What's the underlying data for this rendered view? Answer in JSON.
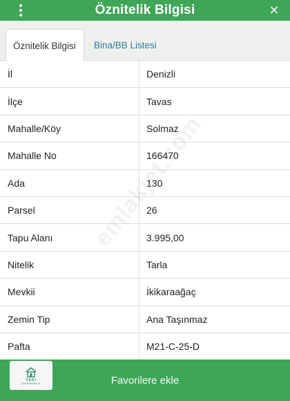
{
  "header": {
    "title": "Öznitelik Bilgisi",
    "menu_icon": "more-vertical-icon",
    "close_icon": "close-icon",
    "close_glyph": "✕",
    "color": "#3fa658"
  },
  "tabs": [
    {
      "label": "Öznitelik Bilgisi",
      "active": true
    },
    {
      "label": "Bina/BB Listesi",
      "active": false
    }
  ],
  "rows": [
    {
      "key": "İl",
      "value": "Denizli"
    },
    {
      "key": "İlçe",
      "value": "Tavas"
    },
    {
      "key": "Mahalle/Köy",
      "value": "Solmaz"
    },
    {
      "key": "Mahalle No",
      "value": "166470"
    },
    {
      "key": "Ada",
      "value": "130"
    },
    {
      "key": "Parsel",
      "value": "26"
    },
    {
      "key": "Tapu Alanı",
      "value": "3.995,00"
    },
    {
      "key": "Nitelik",
      "value": "Tarla"
    },
    {
      "key": "Mevkii",
      "value": "İkikaraağaç"
    },
    {
      "key": "Zemin Tip",
      "value": "Ana Taşınmaz"
    },
    {
      "key": "Pafta",
      "value": "M21-C-25-D"
    }
  ],
  "watermark": "emlakjet.com",
  "footer": {
    "button_label": "Favorilere ekle"
  },
  "logo": {
    "line1": "VEKİ",
    "line2": "GAYRİMENKUL"
  }
}
